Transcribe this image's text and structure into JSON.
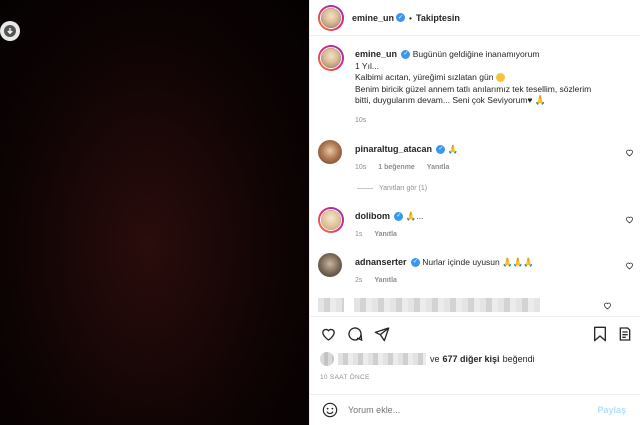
{
  "post": {
    "author": "emine_un",
    "follow_status": "Takiptesin",
    "caption_title": "Bugünün geldiğine inanamıyorum",
    "caption_lines": [
      "1 Yıl...",
      "Kalbimi acıtan, yüreğimi sızlatan gün",
      "Benim biricik güzel annem tatlı anılarımız tek tesellim, sözlerim",
      "bitti, duygularım devam... Seni çok Seviyorum♥"
    ],
    "caption_time": "10s"
  },
  "comments": [
    {
      "user": "pinaraltug_atacan",
      "text": "🙏",
      "time": "10s",
      "likes": "1 beğenme",
      "reply": "Yanıtla"
    },
    {
      "user": "dolibom",
      "text": "🙏...",
      "time": "1s",
      "reply": "Yanıtla"
    },
    {
      "user": "adnanserter",
      "text": "Nurlar içinde uyusun 🙏🙏🙏",
      "time": "2s",
      "reply": "Yanıtla"
    }
  ],
  "replies_toggle": "Yanıtları gör (1)",
  "likes_summary": {
    "and_text": "ve",
    "count_text": "677 diğer kişi",
    "suffix": "beğendi"
  },
  "time_ago": "10 SAAT ÖNCE",
  "comment_box": {
    "placeholder": "Yorum ekle...",
    "post_label": "Paylaş"
  },
  "icons": [
    "download-icon",
    "heart-icon",
    "comment-icon",
    "share-icon",
    "save-icon",
    "emoji-icon",
    "verified-icon"
  ],
  "colors": {
    "verified": "#3897f0",
    "muted": "#8e8e8e",
    "post_disabled": "#b2dffc"
  }
}
